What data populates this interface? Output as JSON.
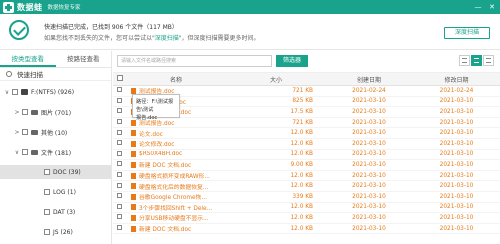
{
  "titlebar": {
    "app_name": "数据蛙",
    "app_sub": "数据恢复专家",
    "minimize_glyph": "—",
    "close_glyph": "✕"
  },
  "info": {
    "line1": "快速扫描已完成，已找到 906 个文件（117 MB）",
    "line2_prefix": "如果您找不到丢失的文件，您可以尝试以\"",
    "line2_link": "深度扫描",
    "line2_suffix": "\"，但深度扫描需要更多时间。",
    "deep_scan_button": "深度扫描"
  },
  "left": {
    "tabs": [
      {
        "label": "按类型查看",
        "active": true
      },
      {
        "label": "按路径查看",
        "active": false
      }
    ],
    "quick_scan_label": "快速扫描",
    "tree": [
      {
        "label": "F:(NTFS) (926)",
        "indent": 0,
        "toggle": "∨",
        "icon": "drive",
        "selected": false
      },
      {
        "label": "图片 (701)",
        "indent": 1,
        "toggle": ">",
        "icon": "folder",
        "selected": false
      },
      {
        "label": "其他 (10)",
        "indent": 1,
        "toggle": ">",
        "icon": "folder",
        "selected": false
      },
      {
        "label": "文件 (181)",
        "indent": 1,
        "toggle": "∨",
        "icon": "folder",
        "selected": false
      },
      {
        "label": "DOC (39)",
        "indent": 2,
        "toggle": "",
        "icon": "none",
        "selected": true
      },
      {
        "label": "LOG (1)",
        "indent": 2,
        "toggle": "",
        "icon": "none",
        "selected": false
      },
      {
        "label": "DAT (3)",
        "indent": 2,
        "toggle": "",
        "icon": "none",
        "selected": false
      },
      {
        "label": "JS (26)",
        "indent": 2,
        "toggle": "",
        "icon": "none",
        "selected": false
      }
    ]
  },
  "right": {
    "search_placeholder": "请输入文件名或路径搜索",
    "filter_button": "筛选器",
    "columns": {
      "name": "名称",
      "size": "大小",
      "created": "创建日期",
      "modified": "修改日期"
    },
    "rows": [
      {
        "name": "测试报告.doc",
        "size": "721 KB",
        "created": "2021-02-24",
        "modified": "2021-02-24"
      },
      {
        "name": "数据恢复专家.doc",
        "size": "825 KB",
        "created": "2021-03-10",
        "modified": "2021-03-10"
      },
      {
        "name": "新建 DOC 文档.doc",
        "size": "17.5 KB",
        "created": "2021-03-10",
        "modified": "2021-03-10"
      },
      {
        "name": "测试报告.doc",
        "size": "721 KB",
        "created": "2021-03-10",
        "modified": "2021-03-10"
      },
      {
        "name": "论文.doc",
        "size": "12.0 KB",
        "created": "2021-03-10",
        "modified": "2021-03-10"
      },
      {
        "name": "论文修改.doc",
        "size": "12.0 KB",
        "created": "2021-03-10",
        "modified": "2021-03-10"
      },
      {
        "name": "$RS0X4BH.doc",
        "size": "12.0 KB",
        "created": "2021-03-10",
        "modified": "2021-03-10"
      },
      {
        "name": "新建 DOC 文档.doc",
        "size": "9.00 KB",
        "created": "2021-03-10",
        "modified": "2021-03-10"
      },
      {
        "name": "硬盘格式损坏变成RAW形...",
        "size": "12.0 KB",
        "created": "2021-03-10",
        "modified": "2021-03-10"
      },
      {
        "name": "硬盘格式化后的数据恢复...",
        "size": "12.0 KB",
        "created": "2021-03-10",
        "modified": "2021-03-10"
      },
      {
        "name": "谷歌Google Chrome恢...",
        "size": "339 KB",
        "created": "2021-03-10",
        "modified": "2021-03-10"
      },
      {
        "name": "3个步骤找回Shift + Dele...",
        "size": "12.0 KB",
        "created": "2021-03-10",
        "modified": "2021-03-10"
      },
      {
        "name": "分享USB移动硬盘不显示...",
        "size": "12.0 KB",
        "created": "2021-03-10",
        "modified": "2021-03-10"
      },
      {
        "name": "新建 DOC 文档.doc",
        "size": "12.0 KB",
        "created": "2021-03-10",
        "modified": "2021-03-10"
      }
    ],
    "tooltip": {
      "line1": "路径：F:\\测试报告\\测试",
      "line2": "报告.doc"
    }
  },
  "colors": {
    "accent": "#19a38c",
    "file_text": "#e77a17"
  }
}
